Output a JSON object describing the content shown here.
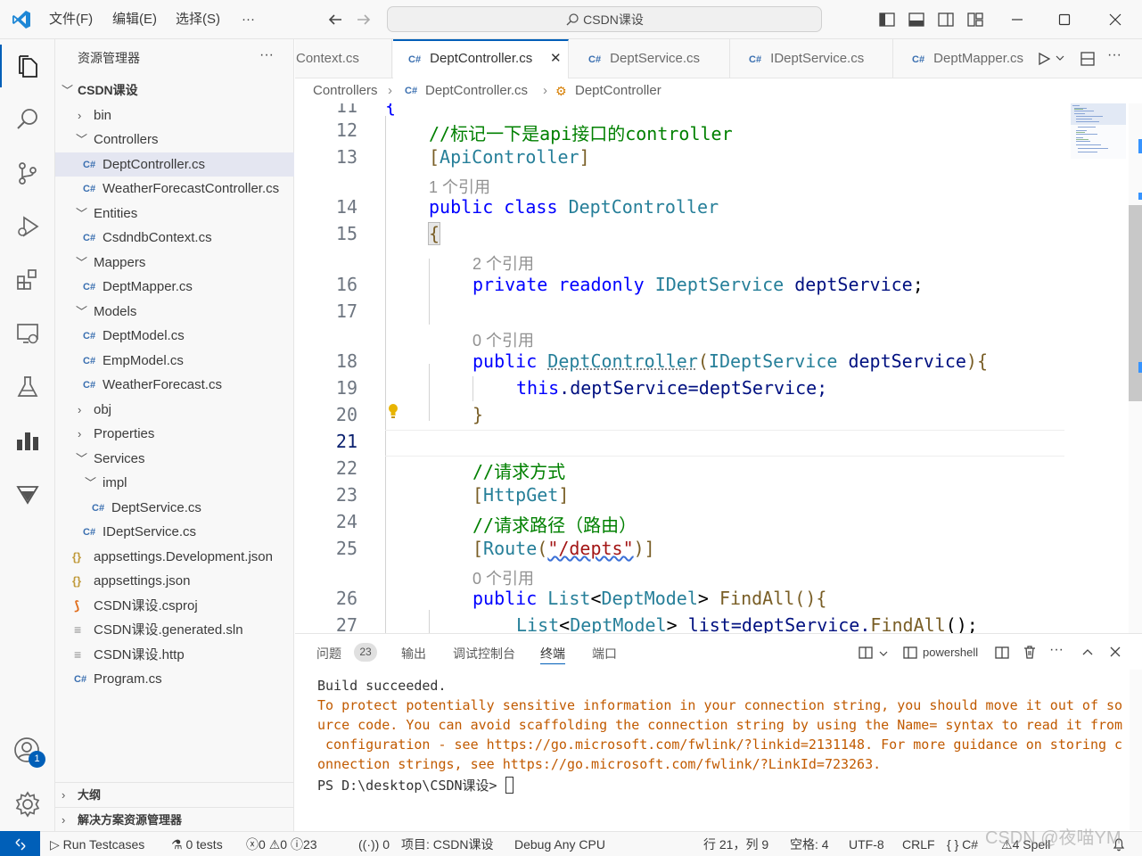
{
  "titlebar": {
    "menus": [
      "文件(F)",
      "编辑(E)",
      "选择(S)",
      "···"
    ],
    "search_text": "CSDN课设"
  },
  "sidebar": {
    "title": "资源管理器",
    "more": "···",
    "root": "CSDN课设",
    "items": [
      {
        "label": "bin",
        "type": "folder-closed"
      },
      {
        "label": "Controllers",
        "type": "folder-open"
      },
      {
        "label": "DeptController.cs",
        "type": "cs"
      },
      {
        "label": "WeatherForecastController.cs",
        "type": "cs"
      },
      {
        "label": "Entities",
        "type": "folder-open"
      },
      {
        "label": "CsdndbContext.cs",
        "type": "cs"
      },
      {
        "label": "Mappers",
        "type": "folder-open"
      },
      {
        "label": "DeptMapper.cs",
        "type": "cs"
      },
      {
        "label": "Models",
        "type": "folder-open"
      },
      {
        "label": "DeptModel.cs",
        "type": "cs"
      },
      {
        "label": "EmpModel.cs",
        "type": "cs"
      },
      {
        "label": "WeatherForecast.cs",
        "type": "cs"
      },
      {
        "label": "obj",
        "type": "folder-closed"
      },
      {
        "label": "Properties",
        "type": "folder-closed"
      },
      {
        "label": "Services",
        "type": "folder-open"
      },
      {
        "label": "impl",
        "type": "folder-open"
      },
      {
        "label": "DeptService.cs",
        "type": "cs"
      },
      {
        "label": "IDeptService.cs",
        "type": "cs"
      },
      {
        "label": "appsettings.Development.json",
        "type": "json"
      },
      {
        "label": "appsettings.json",
        "type": "json"
      },
      {
        "label": "CSDN课设.csproj",
        "type": "rss"
      },
      {
        "label": "CSDN课设.generated.sln",
        "type": "lines"
      },
      {
        "label": "CSDN课设.http",
        "type": "lines"
      },
      {
        "label": "Program.cs",
        "type": "cs"
      }
    ],
    "outline": "大纲",
    "solution": "解决方案资源管理器"
  },
  "tabs": [
    {
      "label": "Context.cs"
    },
    {
      "label": "DeptController.cs"
    },
    {
      "label": "DeptService.cs"
    },
    {
      "label": "IDeptService.cs"
    },
    {
      "label": "DeptMapper.cs"
    }
  ],
  "breadcrumb": [
    "Controllers",
    "DeptController.cs",
    "DeptController"
  ],
  "editor": {
    "line_numbers": [
      "11",
      "12",
      "13",
      "14",
      "15",
      "16",
      "17",
      "18",
      "19",
      "20",
      "21",
      "22",
      "23",
      "24",
      "25",
      "26",
      "27"
    ],
    "lens": [
      "1 个引用",
      "2 个引用",
      "0 个引用",
      "0 个引用"
    ],
    "lines": {
      "l11": "{",
      "l12": "//标记一下是api接口的controller",
      "l13_a": "[",
      "l13_b": "ApiController",
      "l13_c": "]",
      "l14_a": "public",
      "l14_b": "class",
      "l14_c": "DeptController",
      "l15": "{",
      "l16_a": "private",
      "l16_b": "readonly",
      "l16_c": "IDeptService",
      "l16_d": "deptService",
      "l16_e": ";",
      "l18_a": "public",
      "l18_b": "DeptController",
      "l18_c": "(",
      "l18_d": "IDeptService",
      "l18_e": "deptService",
      "l18_f": "){",
      "l19_a": "this",
      "l19_b": ".deptService=deptService;",
      "l20": "}",
      "l22": "//请求方式",
      "l23_a": "[",
      "l23_b": "HttpGet",
      "l23_c": "]",
      "l24": "//请求路径（路由）",
      "l25_a": "[",
      "l25_b": "Route",
      "l25_c": "(",
      "l25_d": "\"/depts\"",
      "l25_e": ")]",
      "l26_a": "public",
      "l26_b": "List",
      "l26_c": "<",
      "l26_d": "DeptModel",
      "l26_e": ">",
      "l26_f": "FindAll",
      "l26_g": "(){",
      "l27_a": "List",
      "l27_b": "<",
      "l27_c": "DeptModel",
      "l27_d": ">",
      "l27_e": "list",
      "l27_f": "=deptService.",
      "l27_g": "FindAll",
      "l27_h": "();"
    }
  },
  "panel": {
    "tabs": [
      "问题",
      "输出",
      "调试控制台",
      "终端",
      "端口"
    ],
    "problems_count": "23",
    "terminal_name": "powershell",
    "more": "···",
    "terminal_lines": [
      "Build succeeded.",
      "To protect potentially sensitive information in your connection string, you should move it out of so",
      "urce code. You can avoid scaffolding the connection string by using the Name= syntax to read it from",
      " configuration - see https://go.microsoft.com/fwlink/?linkid=2131148. For more guidance on storing c",
      "onnection strings, see https://go.microsoft.com/fwlink/?LinkId=723263.",
      "PS D:\\desktop\\CSDN课设> "
    ]
  },
  "account_badge": "1",
  "statusbar": {
    "run_testcases": "Run Testcases",
    "tests": "0 tests",
    "errors": "0",
    "warnings": "0",
    "infos": "23",
    "ports": "0",
    "project": "项目: CSDN课设",
    "debug": "Debug Any CPU",
    "position": "行 21，列 9",
    "spaces": "空格: 4",
    "encoding": "UTF-8",
    "eol": "CRLF",
    "lang_braces": "{ }",
    "language": "C#",
    "spell": "4 Spell",
    "watermark": "CSDN @夜喵YM"
  }
}
